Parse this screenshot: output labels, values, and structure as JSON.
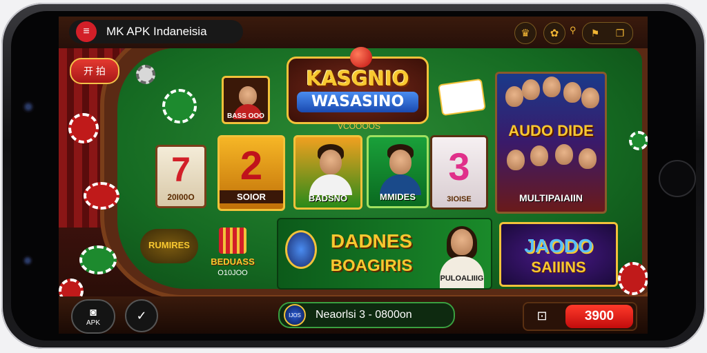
{
  "header": {
    "brand": "MK APK Indaneisia"
  },
  "left_button": {
    "label": "开 拍"
  },
  "main_logo": {
    "line1": "KASGNIO",
    "line2": "WASASINO",
    "subtitle": "VCOOOOS"
  },
  "tiles": [
    {
      "id": "portrait-small",
      "label": "BASS OOO"
    },
    {
      "id": "slot-7",
      "symbol": "7",
      "label": "20I00O"
    },
    {
      "id": "slot-2",
      "symbol": "2",
      "label": "SOIOR"
    },
    {
      "id": "game-badsno",
      "label": "BADSNO"
    },
    {
      "id": "game-mmides",
      "label": "MMIDES"
    },
    {
      "id": "slot-3",
      "symbol": "3",
      "label": "3IOISE"
    },
    {
      "id": "live-audio",
      "title": "AUDO DIDE",
      "label": "MULTIPAIAIIN"
    },
    {
      "id": "rumires",
      "label": "RUMIRES"
    },
    {
      "id": "bebuass",
      "label1": "BEDUASS",
      "label2": "O10JOO"
    },
    {
      "id": "banner-dadnes",
      "line1": "DADNES",
      "line2": "BOAGIRIS",
      "caption": "PULOALIIIG"
    },
    {
      "id": "jaodo",
      "line1": "JAODO",
      "line2": "SAIIINS"
    }
  ],
  "bottom": {
    "apk_label": "APK",
    "search_text": "Neaorlsi 3 - 0800on",
    "search_badge": "IJOS",
    "price": "3900"
  },
  "colors": {
    "felt": "#1d7a2a",
    "gold": "#f2c23a",
    "red": "#d21f28"
  }
}
